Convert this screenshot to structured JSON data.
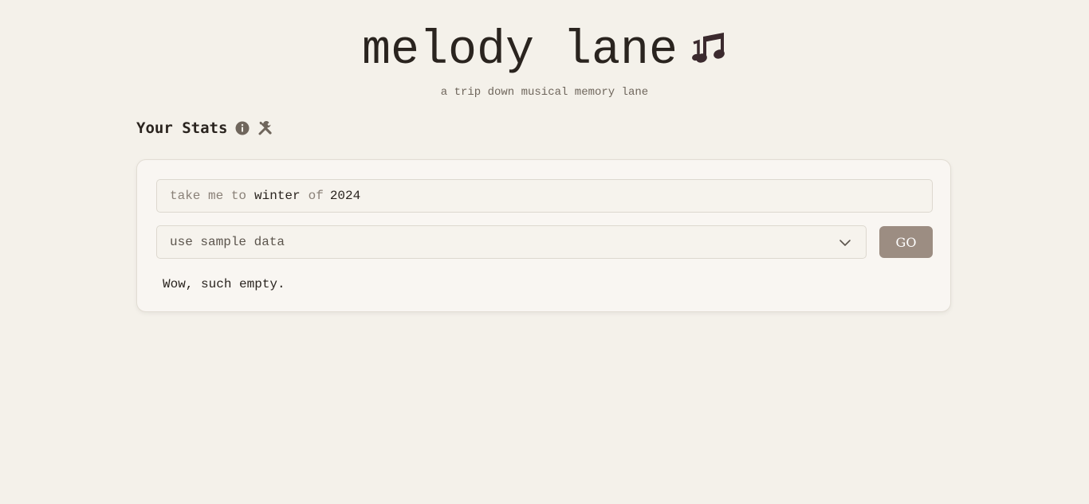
{
  "header": {
    "title": "melody lane",
    "subtitle": "a trip down musical memory lane",
    "title_icon": "musical-notes-icon"
  },
  "stats": {
    "heading": "Your Stats",
    "info_icon": "info-icon",
    "tools_icon": "tools-icon"
  },
  "query": {
    "prefix": "take me to",
    "season": "winter",
    "connector": "of",
    "year": "2024"
  },
  "source_select": {
    "selected": "use sample data"
  },
  "go_button": {
    "label": "GO"
  },
  "results": {
    "empty_message": "Wow, such empty."
  },
  "colors": {
    "background": "#f4f1ea",
    "card": "#f9f6f2",
    "button": "#9c8d82",
    "notes_icon": "#3b2a2e"
  }
}
